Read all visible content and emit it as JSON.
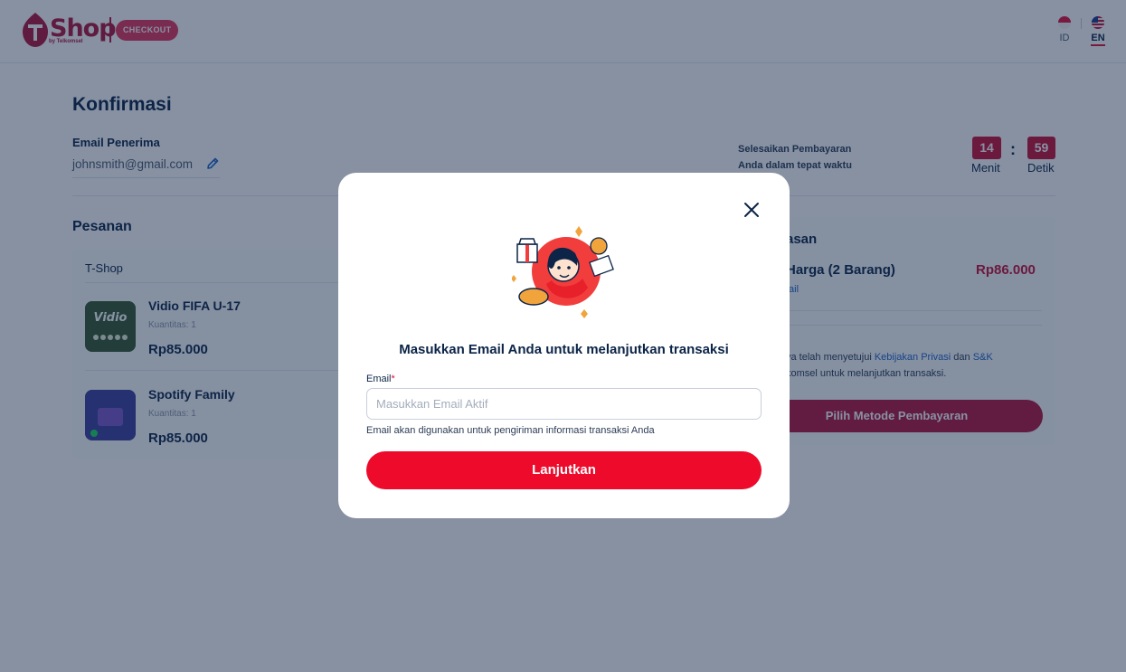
{
  "header": {
    "brand": "Shop",
    "brand_sub": "by Telkomsel",
    "badge": "CHECKOUT",
    "languages": [
      {
        "code": "ID",
        "flag": "id-flag-icon",
        "active": false
      },
      {
        "code": "EN",
        "flag": "us-flag-icon",
        "active": true
      }
    ]
  },
  "page": {
    "title": "Konfirmasi",
    "email_label": "Email Penerima",
    "email_value": "johnsmith@gmail.com",
    "timer": {
      "text_line1": "Selesaikan Pembayaran",
      "text_line2": "Anda dalam tepat waktu",
      "minutes": "14",
      "seconds": "59",
      "minutes_label": "Menit",
      "seconds_label": "Detik"
    }
  },
  "order": {
    "title": "Pesanan",
    "store": "T-Shop",
    "items": [
      {
        "name": "Vidio FIFA U-17",
        "qty": "Kuantitas: 1",
        "price": "Rp85.000"
      },
      {
        "name": "Spotify Family",
        "qty": "Kuantitas: 1",
        "price": "Rp85.000"
      }
    ]
  },
  "summary": {
    "title": "asan",
    "total_label": "Harga (2 Barang)",
    "total_value": "Rp86.000",
    "detail_link": "tail",
    "terms_part1": "ya telah menyetujui ",
    "terms_link1": "Kebijakan Privasi",
    "terms_mid": " dan ",
    "terms_link2": "S&K",
    "terms_part2": "komsel untuk melanjutkan transaksi.",
    "pay_button": "Pilih Metode Pembayaran"
  },
  "modal": {
    "title": "Masukkan Email Anda untuk melanjutkan transaksi",
    "field_label": "Email",
    "required_mark": "*",
    "input_value": "",
    "input_placeholder": "Masukkan Email Aktif",
    "hint": "Email akan digunakan untuk pengiriman informasi transaksi Anda",
    "continue_button": "Lanjutkan",
    "illustration": "woman-with-gift-and-voucher-illustration"
  },
  "colors": {
    "primary_red": "#ee0a2b",
    "brand_maroon": "#b0123a",
    "navy_text": "#0b2447",
    "link_blue": "#1f64c8",
    "overlay": "rgba(16,35,70,0.5)"
  }
}
